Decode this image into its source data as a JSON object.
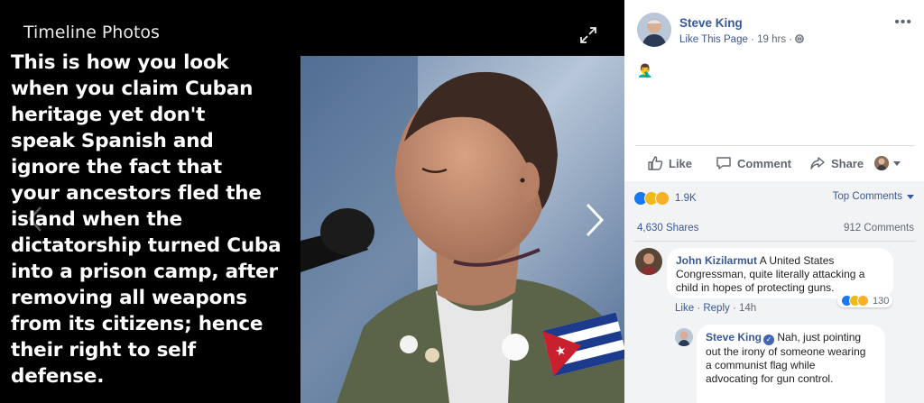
{
  "viewer": {
    "title": "Timeline Photos",
    "caption_lines": [
      "This is how you look",
      "when you claim Cuban",
      "heritage yet don't",
      "speak Spanish and",
      "ignore the fact that",
      "your ancestors fled the",
      "island when the",
      "dictatorship turned  Cuba",
      " into  a prison camp, after",
      "removing all weapons",
      "from its citizens; hence",
      "their right to self",
      "defense."
    ],
    "photo_description": "Young woman with shaved head, eyes closed, at a microphone, olive jacket with pins and a Cuban flag patch"
  },
  "post": {
    "author": "Steve King",
    "like_page": "Like This Page",
    "time": "19 hrs",
    "audience_icon": "globe-icon",
    "body_emoji": "🤦‍♂️",
    "more_label": "•••"
  },
  "actions": {
    "like": "Like",
    "comment": "Comment",
    "share": "Share"
  },
  "stats": {
    "reactions": "1.9K",
    "top_comments": "Top Comments",
    "shares": "4,630 Shares",
    "comments": "912 Comments"
  },
  "comments": [
    {
      "author": "John Kizilarmut",
      "text_lines": [
        " A United States",
        "Congressman, quite literally attacking a",
        "child in hopes of protecting guns."
      ],
      "like": "Like",
      "reply": "Reply",
      "time": "14h",
      "reaction_count": "130"
    },
    {
      "author": "Steve King",
      "verified": true,
      "text_lines": [
        " Nah, just pointing",
        "out the irony of someone wearing",
        "a communist flag while",
        "advocating for gun control."
      ]
    }
  ],
  "colors": {
    "link": "#385898",
    "like_blue": "#1877f2",
    "panel_bg": "#f2f3f5"
  }
}
